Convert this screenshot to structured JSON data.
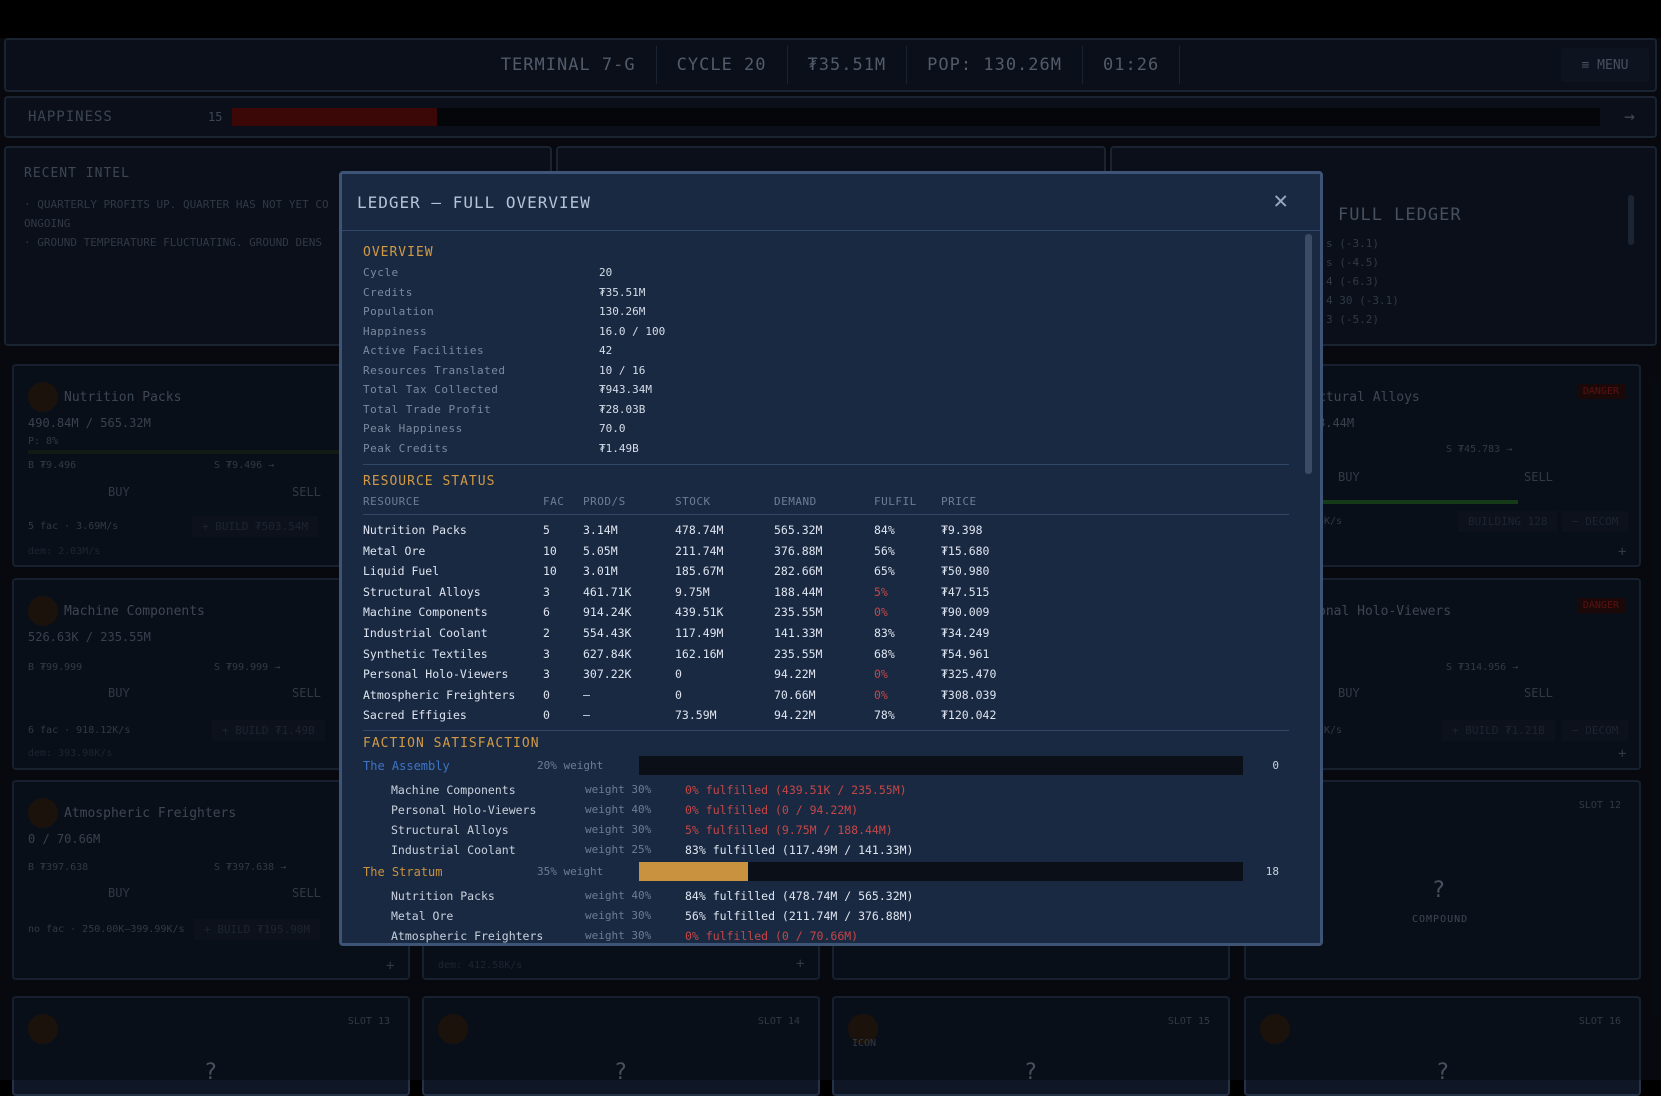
{
  "topbar": {
    "terminal": "TERMINAL 7-G",
    "cycle": "CYCLE 20",
    "credits": "₮35.51M",
    "pop": "POP: 130.26M",
    "time": "01:26",
    "menu": "≡ MENU"
  },
  "happiness": {
    "label": "HAPPINESS",
    "value": "15",
    "fill_fraction": 0.15,
    "arrow": "→"
  },
  "intel": {
    "heading": "RECENT INTEL",
    "lines": [
      "· QUARTERLY PROFITS UP. QUARTER HAS NOT YET CO",
      "ONGOING",
      "· GROUND TEMPERATURE FLUCTUATING. GROUND DENS"
    ]
  },
  "right_panel": {
    "title": "FULL LEDGER",
    "lines": [
      "s (-3.1)",
      "s (-4.5)",
      "4 (-6.3)",
      "4 30 (-3.1)",
      "3 (-5.2)"
    ]
  },
  "cards": {
    "nutrition": {
      "name": "Nutrition Packs",
      "stock": "490.84M / 565.32M",
      "p": "P: 8%",
      "b": "B ₮9.496",
      "s": "S ₮9.496 →",
      "buy": "BUY",
      "sell": "SELL",
      "fac": "5 fac · 3.69M/s",
      "build": "+ BUILD ₮503.54M",
      "dem": "dem: 2.03M/s"
    },
    "machine": {
      "name": "Machine Components",
      "stock": "526.63K / 235.55M",
      "b": "B ₮99.999",
      "s": "S ₮99.999 →",
      "buy": "BUY",
      "sell": "SELL",
      "fac": "6 fac · 918.12K/s",
      "build": "+ BUILD ₮1.49B",
      "dem": "dem: 393.98K/s"
    },
    "atmo": {
      "name": "Atmospheric Freighters",
      "stock": "0 / 70.66M",
      "b": "B ₮397.638",
      "s": "S ₮397.638 →",
      "buy": "BUY",
      "sell": "SELL",
      "fac": "no fac · 250.00K—399.99K/s",
      "build": "+ BUILD ₮195.90M"
    },
    "structural": {
      "name": "ctural Alloys",
      "danger": "DANGER",
      "stock": "8.44M",
      "s": "S ₮45.783 →",
      "buy": "BUY",
      "sell": "SELL",
      "rate": "5K/s",
      "build": "BUILDING 128",
      "decom": "− DECOM",
      "plus": "+"
    },
    "holo": {
      "name": "onal Holo-Viewers",
      "danger": "DANGER",
      "s": "S ₮314.956 →",
      "buy": "BUY",
      "sell": "SELL",
      "rate": "5K/s",
      "build": "+ BUILD ₮1.21B",
      "decom": "− DECOM",
      "plus": "+"
    },
    "slot12": {
      "slot": "SLOT 12",
      "q": "?",
      "label": "COMPOUND"
    },
    "slot13": {
      "slot": "SLOT 13",
      "q": "?"
    },
    "slot14": {
      "slot": "SLOT 14",
      "q": "?"
    },
    "slot15": {
      "slot": "SLOT 15",
      "q": "?",
      "label": "ICON"
    },
    "slot16": {
      "slot": "SLOT 16",
      "q": "?"
    },
    "mid_dem": "dem: 412.58K/s",
    "plus": "+"
  },
  "modal": {
    "title": "LEDGER — FULL OVERVIEW",
    "close": "✕",
    "overview": {
      "heading": "OVERVIEW",
      "rows": [
        {
          "k": "Cycle",
          "v": "20"
        },
        {
          "k": "Credits",
          "v": "₮35.51M"
        },
        {
          "k": "Population",
          "v": "130.26M"
        },
        {
          "k": "Happiness",
          "v": "16.0 / 100"
        },
        {
          "k": "Active Facilities",
          "v": "42"
        },
        {
          "k": "Resources Translated",
          "v": "10 / 16"
        },
        {
          "k": "Total Tax Collected",
          "v": "₮943.34M"
        },
        {
          "k": "Total Trade Profit",
          "v": "₮28.03B"
        },
        {
          "k": "Peak Happiness",
          "v": "70.0"
        },
        {
          "k": "Peak Credits",
          "v": "₮1.49B"
        }
      ]
    },
    "resource_status": {
      "heading": "RESOURCE STATUS",
      "columns": [
        "RESOURCE",
        "FAC",
        "PROD/S",
        "STOCK",
        "DEMAND",
        "FULFIL",
        "PRICE"
      ],
      "rows": [
        {
          "resource": "Nutrition Packs",
          "fac": "5",
          "prod": "3.14M",
          "stock": "478.74M",
          "demand": "565.32M",
          "fulfil": "84%",
          "price": "₮9.398",
          "low": false
        },
        {
          "resource": "Metal Ore",
          "fac": "10",
          "prod": "5.05M",
          "stock": "211.74M",
          "demand": "376.88M",
          "fulfil": "56%",
          "price": "₮15.680",
          "low": false
        },
        {
          "resource": "Liquid Fuel",
          "fac": "10",
          "prod": "3.01M",
          "stock": "185.67M",
          "demand": "282.66M",
          "fulfil": "65%",
          "price": "₮50.980",
          "low": false
        },
        {
          "resource": "Structural Alloys",
          "fac": "3",
          "prod": "461.71K",
          "stock": "9.75M",
          "demand": "188.44M",
          "fulfil": "5%",
          "price": "₮47.515",
          "low": true
        },
        {
          "resource": "Machine Components",
          "fac": "6",
          "prod": "914.24K",
          "stock": "439.51K",
          "demand": "235.55M",
          "fulfil": "0%",
          "price": "₮90.009",
          "low": true
        },
        {
          "resource": "Industrial Coolant",
          "fac": "2",
          "prod": "554.43K",
          "stock": "117.49M",
          "demand": "141.33M",
          "fulfil": "83%",
          "price": "₮34.249",
          "low": false
        },
        {
          "resource": "Synthetic Textiles",
          "fac": "3",
          "prod": "627.84K",
          "stock": "162.16M",
          "demand": "235.55M",
          "fulfil": "68%",
          "price": "₮54.961",
          "low": false
        },
        {
          "resource": "Personal Holo-Viewers",
          "fac": "3",
          "prod": "307.22K",
          "stock": "0",
          "demand": "94.22M",
          "fulfil": "0%",
          "price": "₮325.470",
          "low": true
        },
        {
          "resource": "Atmospheric Freighters",
          "fac": "0",
          "prod": "—",
          "stock": "0",
          "demand": "70.66M",
          "fulfil": "0%",
          "price": "₮308.039",
          "low": true
        },
        {
          "resource": "Sacred Effigies",
          "fac": "0",
          "prod": "—",
          "stock": "73.59M",
          "demand": "94.22M",
          "fulfil": "78%",
          "price": "₮120.042",
          "low": false
        }
      ]
    },
    "factions": {
      "heading": "FACTION SATISFACTION",
      "groups": [
        {
          "name": "The Assembly",
          "color": "#3d74c4",
          "weight": "20% weight",
          "score": "0",
          "fill": 0.0,
          "items": [
            {
              "name": "Machine Components",
              "weight": "weight 30%",
              "fulfilled": "0% fulfilled  (439.51K / 235.55M)",
              "low": true
            },
            {
              "name": "Personal Holo-Viewers",
              "weight": "weight 40%",
              "fulfilled": "0% fulfilled  (0 / 94.22M)",
              "low": true
            },
            {
              "name": "Structural Alloys",
              "weight": "weight 30%",
              "fulfilled": "5% fulfilled  (9.75M / 188.44M)",
              "low": true
            },
            {
              "name": "Industrial Coolant",
              "weight": "weight 25%",
              "fulfilled": "83% fulfilled  (117.49M / 141.33M)",
              "low": false
            }
          ]
        },
        {
          "name": "The Stratum",
          "color": "#c8923e",
          "weight": "35% weight",
          "score": "18",
          "fill": 0.18,
          "items": [
            {
              "name": "Nutrition Packs",
              "weight": "weight 40%",
              "fulfilled": "84% fulfilled  (478.74M / 565.32M)",
              "low": false
            },
            {
              "name": "Metal Ore",
              "weight": "weight 30%",
              "fulfilled": "56% fulfilled  (211.74M / 376.88M)",
              "low": false
            },
            {
              "name": "Atmospheric Freighters",
              "weight": "weight 30%",
              "fulfilled": "0% fulfilled  (0 / 70.66M)",
              "low": true
            }
          ]
        }
      ]
    }
  }
}
